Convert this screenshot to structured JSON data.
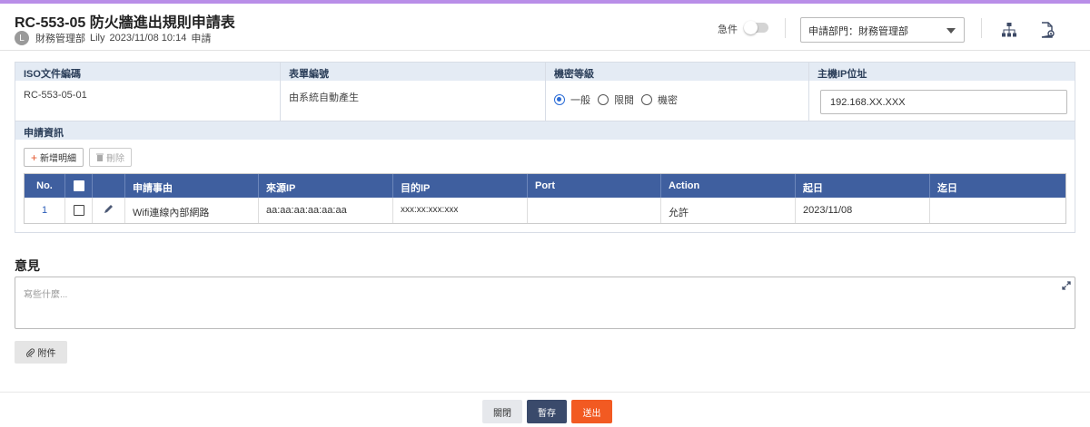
{
  "header": {
    "title": "RC-553-05 防火牆進出規則申請表",
    "avatar_initial": "L",
    "department": "財務管理部",
    "user": "Lily",
    "datetime": "2023/11/08 10:14",
    "status": "申請",
    "urgent_label": "急件",
    "urgent_on": false,
    "dept_select_value": "申請部門：財務管理部",
    "icons": [
      "org-chart-icon",
      "document-settings-icon"
    ]
  },
  "fields": {
    "iso_label": "ISO文件編碼",
    "iso_value": "RC-553-05-01",
    "form_no_label": "表單編號",
    "form_no_value": "由系統自動產生",
    "confidential_label": "機密等級",
    "confidential_options": [
      "一般",
      "限閱",
      "機密"
    ],
    "confidential_selected": "一般",
    "host_ip_label": "主機IP位址",
    "host_ip_value": "192.168.XX.XXX"
  },
  "apply_info": {
    "section_label": "申請資訊",
    "add_button": "新增明細",
    "delete_button": "刪除",
    "columns": [
      "No.",
      "",
      "",
      "申請事由",
      "來源IP",
      "目的IP",
      "Port",
      "Action",
      "起日",
      "迄日"
    ],
    "rows": [
      {
        "no": "1",
        "reason": "Wifi連線內部網路",
        "source_ip": "aa:aa:aa:aa:aa:aa",
        "dest_ip": "xxx:xx:xxx:xxx",
        "port": "",
        "action": "允許",
        "start": "2023/11/08",
        "end": ""
      }
    ]
  },
  "opinion": {
    "title": "意見",
    "placeholder": "寫些什麼..."
  },
  "attach_label": "附件",
  "footer": {
    "close": "關閉",
    "save": "暫存",
    "submit": "送出"
  },
  "colors": {
    "top_bar": "#b98ee8",
    "table_header": "#3f5f9f",
    "field_header": "#e4ebf4",
    "radio_selected": "#2b6cd6",
    "save_button": "#3a4a6b",
    "submit_button": "#f25a22"
  }
}
